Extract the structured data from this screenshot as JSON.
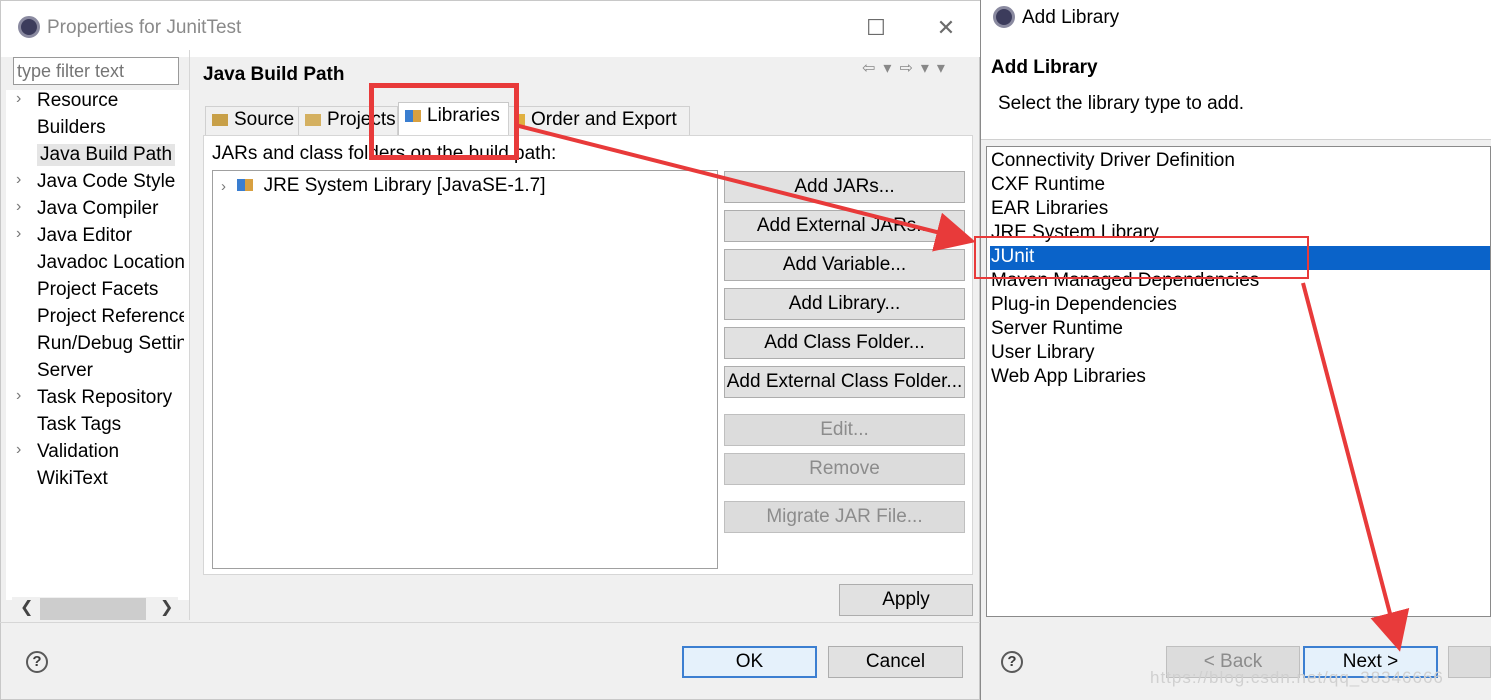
{
  "properties_dialog": {
    "title": "Properties for JunitTest",
    "window_buttons": {
      "maximize": "☐",
      "close": "✕"
    },
    "filter_placeholder": "type filter text",
    "tree": [
      {
        "label": "Resource",
        "expandable": true
      },
      {
        "label": "Builders",
        "expandable": false
      },
      {
        "label": "Java Build Path",
        "expandable": false,
        "selected": true
      },
      {
        "label": "Java Code Style",
        "expandable": true
      },
      {
        "label": "Java Compiler",
        "expandable": true
      },
      {
        "label": "Java Editor",
        "expandable": true
      },
      {
        "label": "Javadoc Location",
        "expandable": false
      },
      {
        "label": "Project Facets",
        "expandable": false
      },
      {
        "label": "Project References",
        "expandable": false
      },
      {
        "label": "Run/Debug Settings",
        "expandable": false
      },
      {
        "label": "Server",
        "expandable": false
      },
      {
        "label": "Task Repository",
        "expandable": true
      },
      {
        "label": "Task Tags",
        "expandable": false
      },
      {
        "label": "Validation",
        "expandable": true
      },
      {
        "label": "WikiText",
        "expandable": false
      }
    ],
    "page_title": "Java Build Path",
    "tabs": [
      {
        "label": "Source",
        "active": false
      },
      {
        "label": "Projects",
        "active": false
      },
      {
        "label": "Libraries",
        "active": true
      },
      {
        "label": "Order and Export",
        "active": false
      }
    ],
    "panel_label": "JARs and class folders on the build path:",
    "libraries": [
      {
        "label": "JRE System Library [JavaSE-1.7]"
      }
    ],
    "buttons": {
      "add_jars": "Add JARs...",
      "add_external_jars": "Add External JARs...",
      "add_variable": "Add Variable...",
      "add_library": "Add Library...",
      "add_class_folder": "Add Class Folder...",
      "add_external_class_folder": "Add External Class Folder...",
      "edit": "Edit...",
      "remove": "Remove",
      "migrate": "Migrate JAR File...",
      "apply": "Apply",
      "ok": "OK",
      "cancel": "Cancel",
      "help": "?"
    }
  },
  "add_library_dialog": {
    "window_title": "Add Library",
    "heading": "Add Library",
    "description": "Select the library type to add.",
    "library_types": [
      {
        "label": "Connectivity Driver Definition",
        "selected": false
      },
      {
        "label": "CXF Runtime",
        "selected": false
      },
      {
        "label": "EAR Libraries",
        "selected": false
      },
      {
        "label": "JRE System Library",
        "selected": false
      },
      {
        "label": "JUnit",
        "selected": true
      },
      {
        "label": "Maven Managed Dependencies",
        "selected": false
      },
      {
        "label": "Plug-in Dependencies",
        "selected": false
      },
      {
        "label": "Server Runtime",
        "selected": false
      },
      {
        "label": "User Library",
        "selected": false
      },
      {
        "label": "Web App Libraries",
        "selected": false
      }
    ],
    "buttons": {
      "back": "< Back",
      "next": "Next >",
      "help": "?"
    }
  },
  "watermark": "https://blog.csdn.net/qq_38346666",
  "colors": {
    "selection": "#0a63c9",
    "annotation": "#e83a3a",
    "default_button_border": "#3c7fd1"
  }
}
